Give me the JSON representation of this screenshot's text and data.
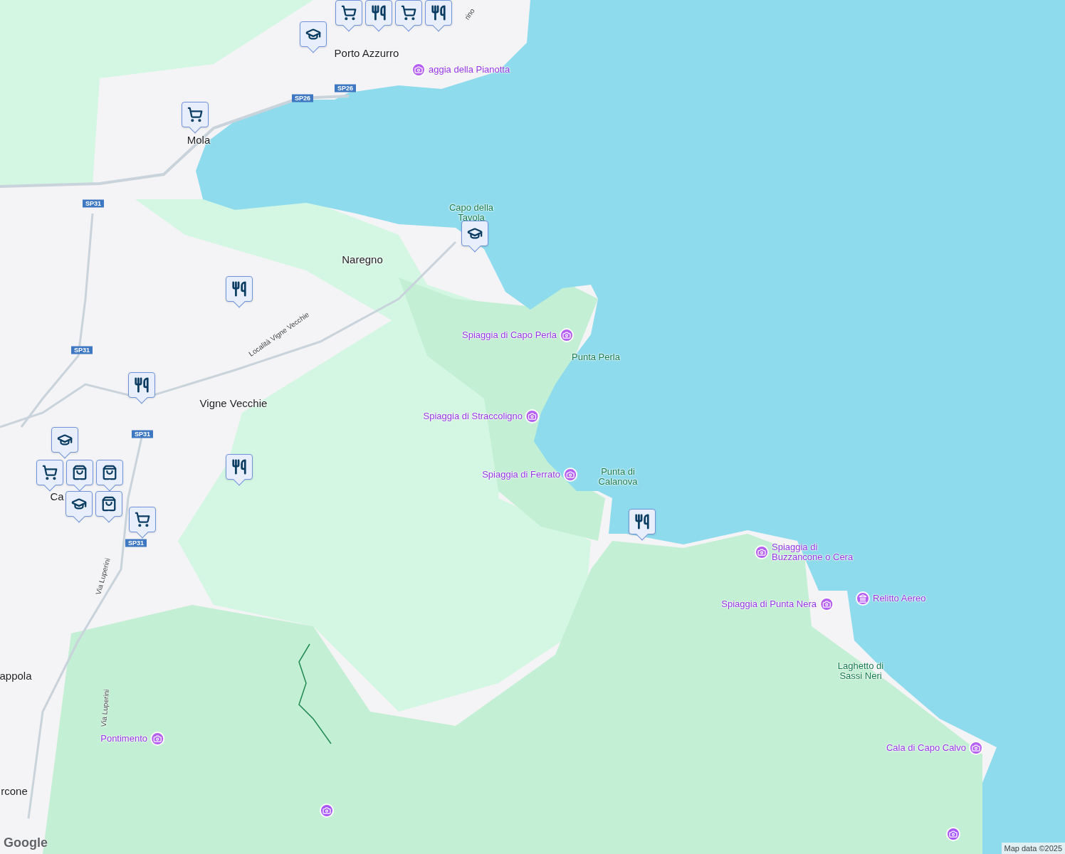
{
  "labels": [
    {
      "kind": "town",
      "text": "Porto Azzurro"
    },
    {
      "kind": "beach",
      "text": "aggia della Pianotta"
    },
    {
      "kind": "road",
      "text": "rino"
    },
    {
      "kind": "town",
      "text": "Mola"
    },
    {
      "kind": "natural",
      "text": "Capo della Tavola"
    },
    {
      "kind": "town",
      "text": "Naregno"
    },
    {
      "kind": "road",
      "text": "Località Vigne Vecchie"
    },
    {
      "kind": "beach",
      "text": "Spiaggia di Capo Perla"
    },
    {
      "kind": "natural",
      "text": "Punta Perla"
    },
    {
      "kind": "town",
      "text": "Vigne Vecchie"
    },
    {
      "kind": "beach",
      "text": "Spiaggia di Straccoligno"
    },
    {
      "kind": "beach",
      "text": "Spiaggia di Ferrato"
    },
    {
      "kind": "natural",
      "text": "Punta di Calanova"
    },
    {
      "kind": "beach",
      "text": "Spiaggia di Buzzancone o Cera"
    },
    {
      "kind": "beach",
      "text": "Spiaggia di Punta Nera"
    },
    {
      "kind": "museum",
      "text": "Relitto Aereo"
    },
    {
      "kind": "natural",
      "text": "Laghetto di Sassi Neri"
    },
    {
      "kind": "town",
      "text": "Ca"
    },
    {
      "kind": "road",
      "text": "Via Luperini"
    },
    {
      "kind": "road",
      "text": "Via Luperini"
    },
    {
      "kind": "town",
      "text": "appola"
    },
    {
      "kind": "beach",
      "text": "Pontimento"
    },
    {
      "kind": "town",
      "text": "rcone"
    },
    {
      "kind": "beach",
      "text": "Cala di Capo Calvo"
    }
  ],
  "shields": [
    "SP26",
    "SP26",
    "SP31",
    "SP31",
    "SP31",
    "SP31"
  ],
  "markers": [
    {
      "kind": "school"
    },
    {
      "kind": "cart"
    },
    {
      "kind": "restaurant"
    },
    {
      "kind": "cart"
    },
    {
      "kind": "restaurant"
    },
    {
      "kind": "cart"
    },
    {
      "kind": "school"
    },
    {
      "kind": "restaurant"
    },
    {
      "kind": "restaurant"
    },
    {
      "kind": "restaurant"
    },
    {
      "kind": "restaurant"
    },
    {
      "kind": "school"
    },
    {
      "kind": "cart"
    },
    {
      "kind": "bag"
    },
    {
      "kind": "bag"
    },
    {
      "kind": "school"
    },
    {
      "kind": "bag"
    },
    {
      "kind": "cart"
    },
    {
      "kind": "camera-pin"
    },
    {
      "kind": "camera-pin"
    }
  ],
  "logo": "Google",
  "attribution": "Map data ©2025"
}
